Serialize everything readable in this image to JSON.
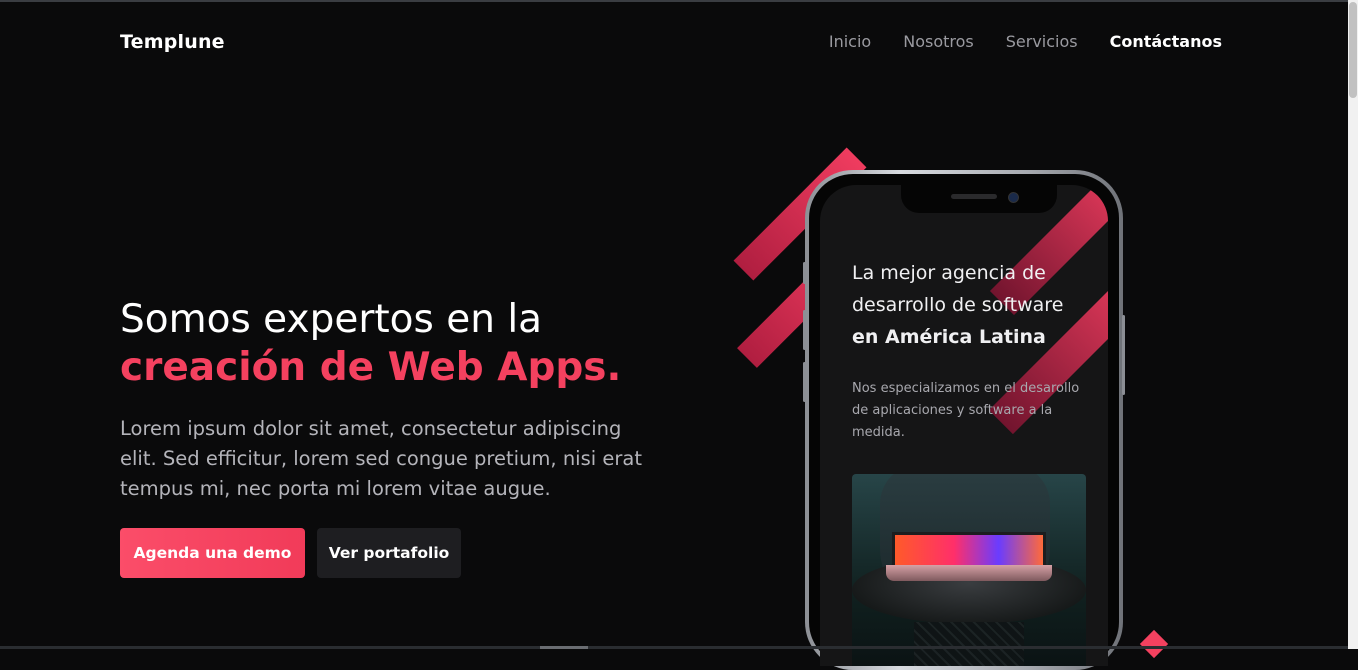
{
  "header": {
    "brand": "Templune",
    "nav": [
      {
        "label": "Inicio"
      },
      {
        "label": "Nosotros"
      },
      {
        "label": "Servicios"
      },
      {
        "label": "Contáctanos"
      }
    ]
  },
  "hero": {
    "title_line1": "Somos expertos en la",
    "title_line2": "creación de Web Apps.",
    "description": "Lorem ipsum dolor sit amet, consectetur adipiscing elit. Sed efficitur, lorem sed congue pretium, nisi erat tempus mi, nec porta mi lorem vitae augue.",
    "primary_button": "Agenda una demo",
    "secondary_button": "Ver portafolio"
  },
  "phone": {
    "title_line1": "La mejor agencia de desarrollo de software",
    "title_line2": "en América Latina",
    "text": "Nos especializamos en el desarollo de aplicaciones y software a la medida."
  },
  "colors": {
    "accent": "#f4415f",
    "background": "#0a0a0b",
    "secondary_button": "#1e1e21"
  },
  "icons": [
    "camera-icon",
    "speaker-icon"
  ]
}
